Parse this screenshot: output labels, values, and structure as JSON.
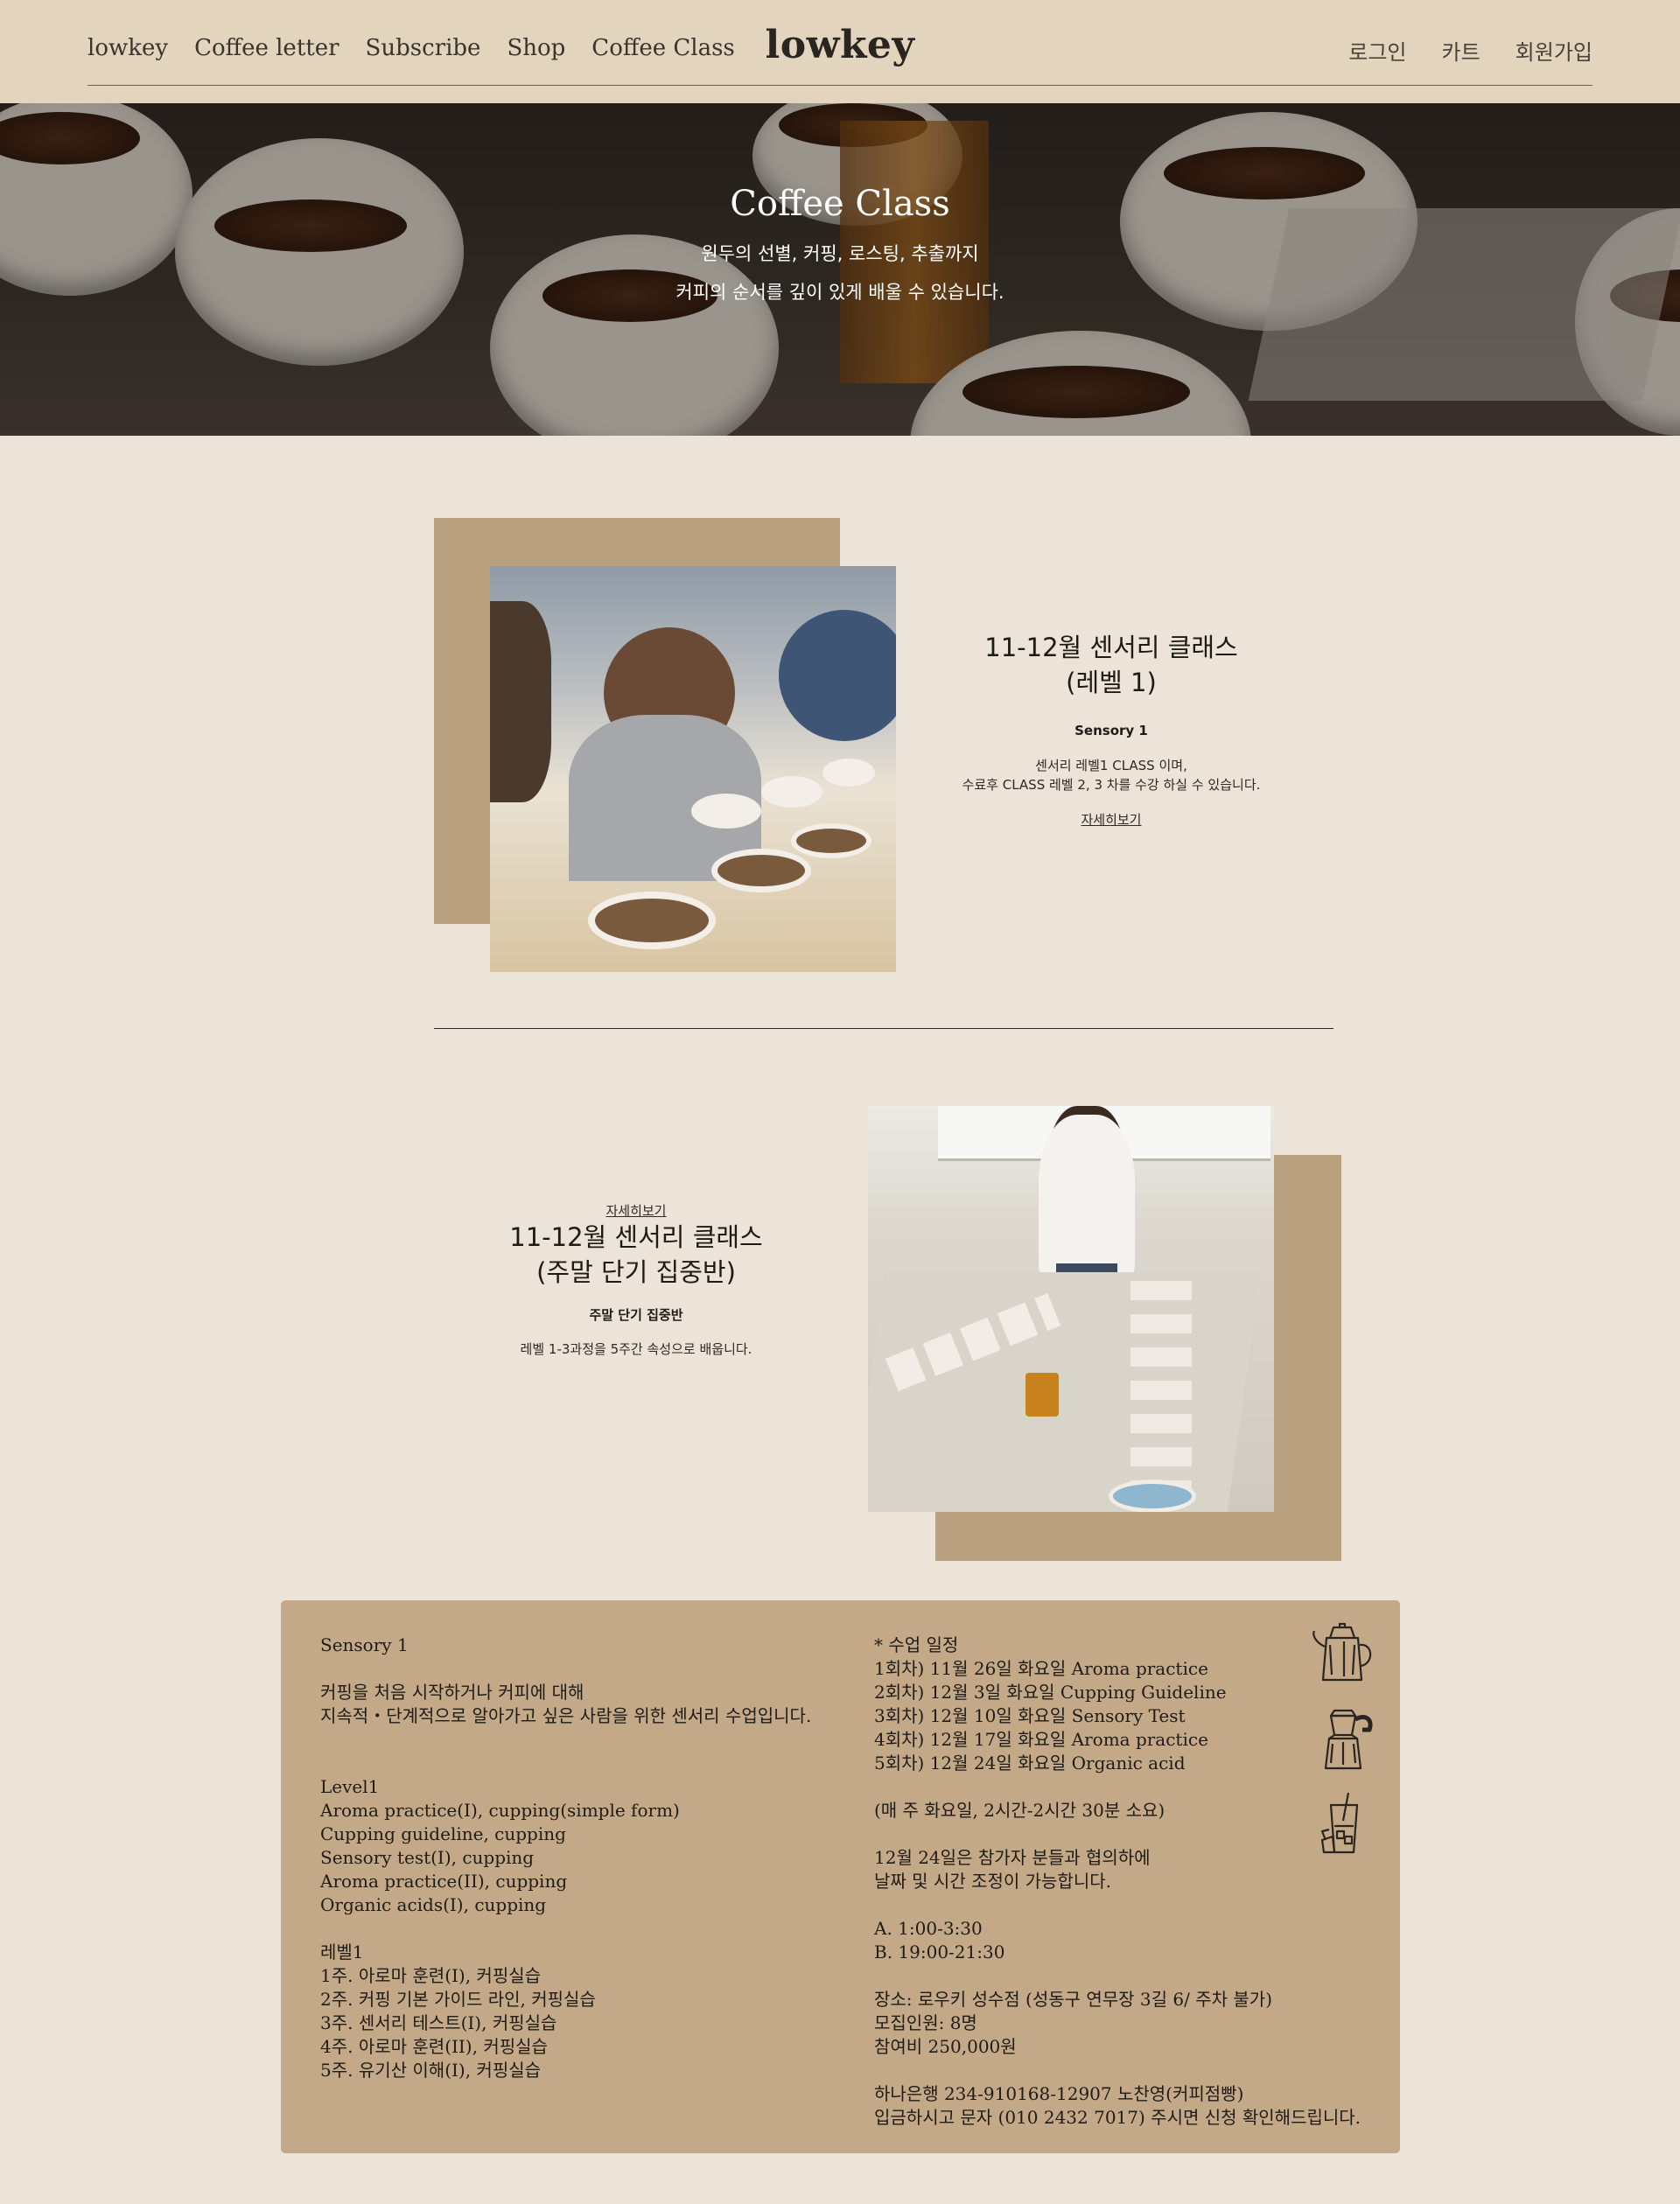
{
  "header": {
    "nav_left": [
      "lowkey",
      "Coffee letter",
      "Subscribe",
      "Shop",
      "Coffee Class"
    ],
    "brand": "lowkey",
    "nav_right": [
      "로그인",
      "카트",
      "회원가입"
    ]
  },
  "hero": {
    "title": "Coffee Class",
    "subtitle_line1": "원두의 선별, 커핑, 로스팅, 추출까지",
    "subtitle_line2": "커피의 순서를 깊이 있게 배울 수 있습니다."
  },
  "class1": {
    "title_line1": "11-12월 센서리 클래스",
    "title_line2": "(레벨 1)",
    "subtitle": "Sensory 1",
    "desc_line1": "센서리 레벨1 CLASS 이며,",
    "desc_line2": "수료후 CLASS 레벨 2, 3 차를 수강 하실 수 있습니다.",
    "link": "자세히보기"
  },
  "class2": {
    "link": "자세히보기",
    "title_line1": "11-12월 센서리 클래스",
    "title_line2": "(주말 단기 집중반)",
    "subtitle": "주말 단기 집중반",
    "desc": "레벨 1-3과정을 5주간 속성으로 배웁니다."
  },
  "info": {
    "left": {
      "heading": "Sensory 1",
      "intro": [
        "커핑을 처음 시작하거나 커피에 대해",
        "지속적・단계적으로 알아가고 싶은 사람을 위한 센서리 수업입니다."
      ],
      "level_en_title": "Level1",
      "level_en_items": [
        "Aroma practice(I), cupping(simple form)",
        "Cupping guideline, cupping",
        "Sensory test(I), cupping",
        "Aroma practice(II), cupping",
        "Organic acids(I), cupping"
      ],
      "level_ko_title": "레벨1",
      "level_ko_items": [
        "1주. 아로마 훈련(I), 커핑실습",
        "2주. 커핑 기본 가이드 라인, 커핑실습",
        "3주. 센서리 테스트(I), 커핑실습",
        "4주. 아로마 훈련(II), 커핑실습",
        "5주. 유기산 이해(I), 커핑실습"
      ]
    },
    "right": {
      "schedule_title": "* 수업 일정",
      "schedule": [
        "1회차) 11월 26일 화요일 Aroma practice",
        "2회차) 12월 3일 화요일 Cupping Guideline",
        "3회차) 12월 10일 화요일 Sensory Test",
        "4회차) 12월 17일 화요일 Aroma practice",
        "5회차)  12월 24일 화요일 Organic acid"
      ],
      "weekly": "(매 주 화요일, 2시간-2시간 30분 소요)",
      "adjust": [
        "12월 24일은 참가자 분들과 협의하에",
        "날짜 및 시간 조정이 가능합니다."
      ],
      "times": [
        "A. 1:00-3:30",
        "B.   19:00-21:30"
      ],
      "details": [
        "장소: 로우키 성수점 (성동구 연무장 3길 6/ 주차 불가)",
        "모집인원: 8명",
        "참여비 250,000원"
      ],
      "payment": [
        "하나은행 234-910168-12907 노찬영(커피점빵)",
        "입금하시고 문자 (010 2432 7017) 주시면 신청 확인해드립니다."
      ]
    },
    "icons": [
      "kettle-icon",
      "moka-pot-icon",
      "iced-coffee-icon"
    ]
  }
}
